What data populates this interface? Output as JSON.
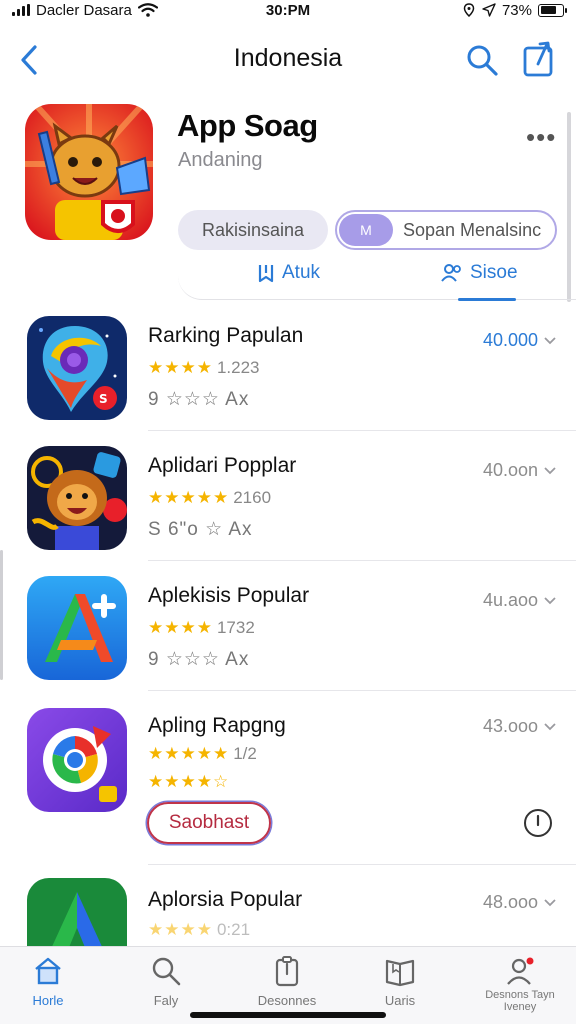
{
  "status_bar": {
    "carrier": "Dacler Dasara",
    "time": "30:PM",
    "battery": "73%",
    "battery_level": 0.73
  },
  "nav": {
    "title": "Indonesia",
    "back_icon": "chevron-left-icon",
    "search_icon": "search-icon",
    "share_icon": "share-icon"
  },
  "header": {
    "title": "App Soag",
    "subtitle": "Andaning",
    "more": "•••",
    "pill_left": "Rakisinsaina",
    "pill_right_chip": "M",
    "pill_right": "Sopan Menalsinc",
    "segments": [
      {
        "label": "Atuk",
        "icon": "bookmark-icon"
      },
      {
        "label": "Sisoe",
        "icon": "people-icon"
      }
    ]
  },
  "apps": [
    {
      "name": "Rarking Papulan",
      "rating": "1.223",
      "stars": "★★★★",
      "sub": "9 ☆☆☆ Ax",
      "price": "40.000",
      "price_accent": true
    },
    {
      "name": "Aplidari Popplar",
      "rating": "2160",
      "stars": "★★★★★",
      "sub": "S 6\"o ☆ Ax",
      "price": "40.oon",
      "price_accent": false
    },
    {
      "name": "Aplekisis Popular",
      "rating": "1732",
      "stars": "★★★★",
      "sub": "9 ☆☆☆ Ax",
      "price": "4u.aoo",
      "price_accent": false
    },
    {
      "name": "Apling Rapgng",
      "rating": "1/2",
      "stars": "★★★★★",
      "stars2": "★★★★☆",
      "button": "Saobhast",
      "price": "43.ooo",
      "price_accent": false
    },
    {
      "name": "Aplorsia Popular",
      "rating": "0:21",
      "stars": "★★★★",
      "price": "48.ooo",
      "price_accent": false
    }
  ],
  "tabs": [
    {
      "label": "Horle",
      "icon": "home-icon",
      "active": true
    },
    {
      "label": "Faly",
      "icon": "search-icon",
      "active": false
    },
    {
      "label": "Desonnes",
      "icon": "clipboard-icon",
      "active": false
    },
    {
      "label": "Uaris",
      "icon": "book-icon",
      "active": false
    },
    {
      "label": "Desnons Tayn Iveney",
      "icon": "person-icon",
      "active": false
    }
  ],
  "colors": {
    "accent": "#2b7bd6",
    "star": "#f5b400",
    "red_button": "#b52b40",
    "pill_chip": "#a79ce8"
  }
}
